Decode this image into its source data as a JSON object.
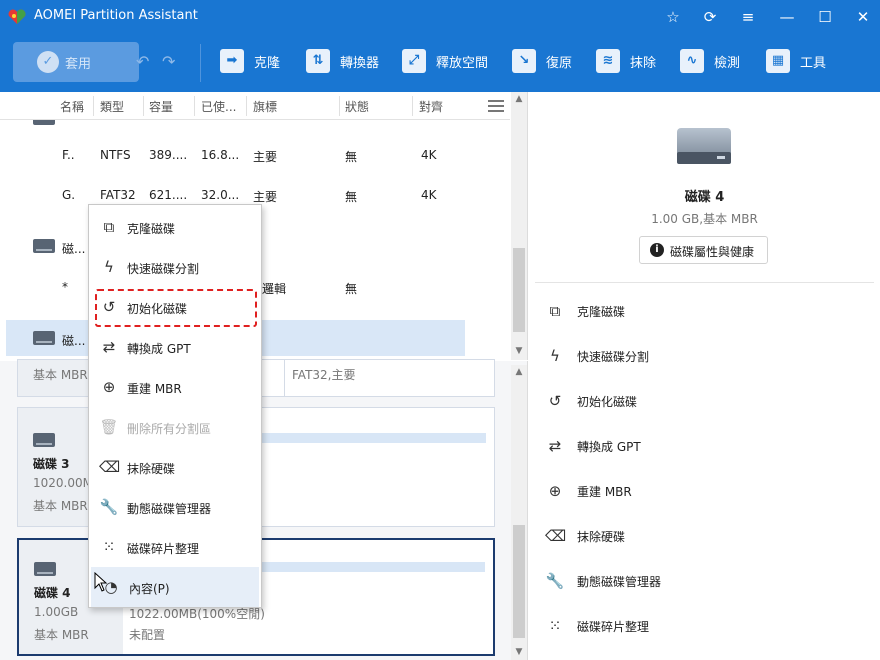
{
  "title_bar": {
    "app_title": "AOMEI Partition Assistant",
    "icons": [
      "star-icon",
      "refresh-icon",
      "menu-icon",
      "minimize-icon",
      "maximize-icon",
      "close-icon"
    ]
  },
  "toolbar": {
    "apply_label": "套用",
    "tools": [
      {
        "name": "clone",
        "label": "克隆",
        "icon": "clone-tool-icon"
      },
      {
        "name": "convert",
        "label": "轉換器",
        "icon": "convert-tool-icon"
      },
      {
        "name": "free-space",
        "label": "釋放空間",
        "icon": "free-space-tool-icon"
      },
      {
        "name": "recover",
        "label": "復原",
        "icon": "recover-tool-icon"
      },
      {
        "name": "wipe",
        "label": "抹除",
        "icon": "wipe-tool-icon"
      },
      {
        "name": "check",
        "label": "檢測",
        "icon": "check-tool-icon"
      },
      {
        "name": "tools",
        "label": "工具",
        "icon": "tools-icon"
      }
    ]
  },
  "partition_table": {
    "columns": [
      "名稱",
      "類型",
      "容量",
      "已使...",
      "旗標",
      "狀態",
      "對齊"
    ],
    "rows": [
      {
        "name": "F..",
        "type": "NTFS",
        "capacity": "389....",
        "used": "16.8...",
        "flag": "主要",
        "status": "無",
        "align": "4K"
      },
      {
        "name": "G.",
        "type": "FAT32",
        "capacity": "621....",
        "used": "32.0...",
        "flag": "主要",
        "status": "無",
        "align": "4K"
      }
    ],
    "disk_row_1": "磁...",
    "star_row": {
      "name": "*",
      "flag_tail": "邏輯",
      "status": "無"
    },
    "disk_row_2": "磁..."
  },
  "disk_cards": {
    "card_top": {
      "info": "基本 MBR",
      "part_info": "FAT32,主要"
    },
    "disk3": {
      "name": "磁碟 3",
      "size": "1020.00MB",
      "type": "基本 MBR"
    },
    "disk4": {
      "name": "磁碟 4",
      "size": "1.00GB",
      "type": "基本 MBR",
      "part_size": "1022.00MB(100%空閒)",
      "part_status": "未配置"
    }
  },
  "right_panel": {
    "disk_title": "磁碟 4",
    "disk_sub": "1.00 GB,基本 MBR",
    "props_button": "磁碟屬性與健康",
    "actions": [
      {
        "label": "克隆磁碟",
        "icon": "clone-disk-icon"
      },
      {
        "label": "快速磁碟分割",
        "icon": "lightning-icon"
      },
      {
        "label": "初始化磁碟",
        "icon": "initialize-icon"
      },
      {
        "label": "轉換成 GPT",
        "icon": "convert-icon"
      },
      {
        "label": "重建 MBR",
        "icon": "rebuild-icon"
      },
      {
        "label": "抹除硬碟",
        "icon": "eraser-icon"
      },
      {
        "label": "動態磁碟管理器",
        "icon": "wrench-icon"
      },
      {
        "label": "磁碟碎片整理",
        "icon": "defrag-icon"
      }
    ]
  },
  "context_menu": {
    "items": [
      {
        "label": "克隆磁碟",
        "icon": "clone-disk-icon"
      },
      {
        "label": "快速磁碟分割",
        "icon": "lightning-icon"
      },
      {
        "label": "初始化磁碟",
        "icon": "initialize-icon"
      },
      {
        "label": "轉換成 GPT",
        "icon": "convert-icon"
      },
      {
        "label": "重建 MBR",
        "icon": "rebuild-icon"
      },
      {
        "label": "刪除所有分割區",
        "icon": "trash-icon"
      },
      {
        "label": "抹除硬碟",
        "icon": "eraser-icon"
      },
      {
        "label": "動態磁碟管理器",
        "icon": "wrench-icon"
      },
      {
        "label": "磁碟碎片整理",
        "icon": "defrag-icon"
      },
      {
        "label": "內容(P)",
        "icon": "properties-icon"
      }
    ]
  },
  "colors": {
    "accent": "#1976d2",
    "highlight": "#e02020",
    "selection": "#d9e7f7"
  }
}
